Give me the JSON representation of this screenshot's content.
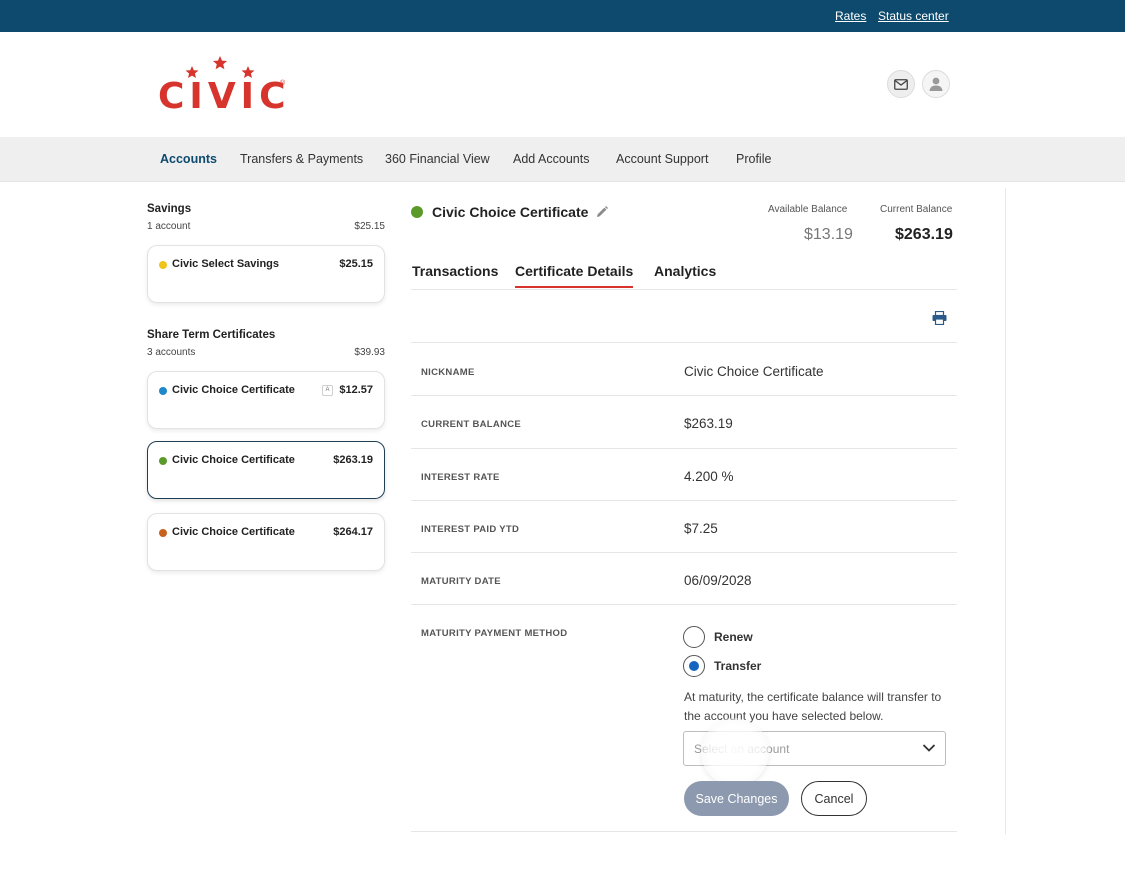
{
  "topbar": {
    "links": [
      "Rates",
      "Status center"
    ]
  },
  "brand": {
    "name": "CIVIC",
    "mark": "®"
  },
  "header": {
    "icons": [
      "mail-icon",
      "user-avatar-icon"
    ]
  },
  "nav": {
    "items": [
      "Accounts",
      "Transfers & Payments",
      "360 Financial View",
      "Add Accounts",
      "Account Support",
      "Profile"
    ],
    "active": "Accounts"
  },
  "sidebar": {
    "savings": {
      "title": "Savings",
      "count": "1 account",
      "total": "$25.15",
      "accounts": [
        {
          "name": "Civic Select Savings",
          "amount": "$25.15",
          "color": "#f0c419"
        }
      ]
    },
    "certificates": {
      "title": "Share Term Certificates",
      "count": "3 accounts",
      "total": "$39.93",
      "accounts": [
        {
          "name": "Civic Choice Certificate",
          "amount": "$12.57",
          "color": "#1e88c8",
          "badge": "A"
        },
        {
          "name": "Civic Choice Certificate",
          "amount": "$263.19",
          "color": "#5b9a2a",
          "selected": true
        },
        {
          "name": "Civic Choice Certificate",
          "amount": "$264.17",
          "color": "#c8611e"
        }
      ]
    }
  },
  "account": {
    "title": "Civic Choice Certificate",
    "status_color": "#5b9a2a",
    "available_label": "Available Balance",
    "available": "$13.19",
    "current_label": "Current Balance",
    "current": "$263.19"
  },
  "tabs": {
    "items": [
      "Transactions",
      "Certificate Details",
      "Analytics"
    ],
    "active": "Certificate Details"
  },
  "details": {
    "rows": [
      {
        "label": "NICKNAME",
        "value": "Civic Choice Certificate"
      },
      {
        "label": "CURRENT BALANCE",
        "value": "$263.19"
      },
      {
        "label": "INTEREST RATE",
        "value": "4.200 %"
      },
      {
        "label": "INTEREST PAID YTD",
        "value": "$7.25"
      },
      {
        "label": "MATURITY DATE",
        "value": "06/09/2028"
      }
    ],
    "maturity_method": {
      "label": "MATURITY PAYMENT METHOD",
      "options": [
        "Renew",
        "Transfer"
      ],
      "selected": "Transfer",
      "help": "At maturity, the certificate balance will transfer to the account you have selected below.",
      "select_placeholder": "Select an account"
    },
    "actions": {
      "save": "Save Changes",
      "cancel": "Cancel"
    }
  },
  "colors": {
    "topbar": "#0e4a6e",
    "brand_red": "#d6342c",
    "nav_bg": "#efefef",
    "radio_selected": "#1565c0",
    "save_button": "#8d99ae"
  }
}
